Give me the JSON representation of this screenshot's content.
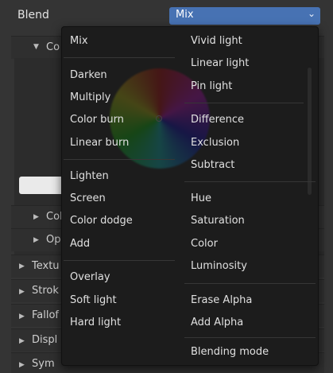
{
  "blend": {
    "label": "Blend",
    "value": "Mix"
  },
  "panel": {
    "color_picker_label": "Color Picker",
    "color_picker_visible": "Co",
    "rows": [
      {
        "label": "Texture",
        "visible": "Textu"
      },
      {
        "label": "Stroke",
        "visible": "Strok"
      },
      {
        "label": "Falloff",
        "visible": "Fallof"
      },
      {
        "label": "Display",
        "visible": "Displ"
      },
      {
        "label": "Symmetry",
        "visible": "Sym"
      }
    ],
    "sub_rows": [
      {
        "visible": "Col"
      },
      {
        "visible": "Op"
      }
    ]
  },
  "menu": {
    "left": [
      {
        "label": "Mix"
      },
      {
        "label": "Darken"
      },
      {
        "label": "Multiply"
      },
      {
        "label": "Color burn"
      },
      {
        "label": "Linear burn"
      },
      {
        "label": "Lighten"
      },
      {
        "label": "Screen"
      },
      {
        "label": "Color dodge"
      },
      {
        "label": "Add"
      },
      {
        "label": "Overlay"
      },
      {
        "label": "Soft light"
      },
      {
        "label": "Hard light"
      }
    ],
    "right": [
      {
        "label": "Vivid light"
      },
      {
        "label": "Linear light"
      },
      {
        "label": "Pin light"
      },
      {
        "label": "Difference"
      },
      {
        "label": "Exclusion"
      },
      {
        "label": "Subtract"
      },
      {
        "label": "Hue"
      },
      {
        "label": "Saturation"
      },
      {
        "label": "Color"
      },
      {
        "label": "Luminosity"
      },
      {
        "label": "Erase Alpha"
      },
      {
        "label": "Add Alpha"
      },
      {
        "label": "Blending mode"
      }
    ]
  },
  "colors": {
    "accent": "#4772b3",
    "menu_bg": "#1c1c1c"
  }
}
